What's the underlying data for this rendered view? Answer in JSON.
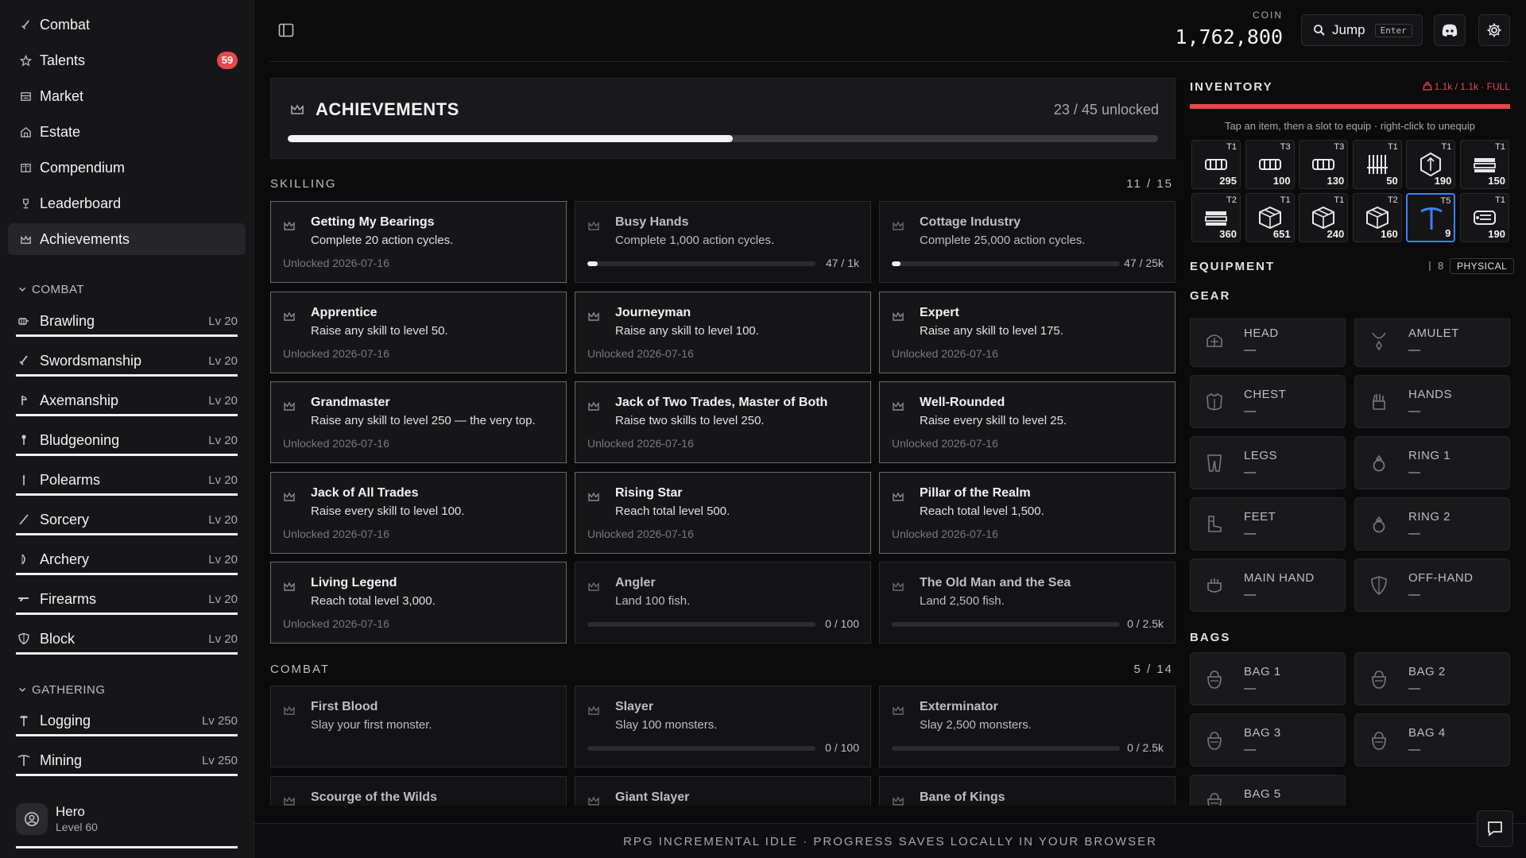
{
  "sidebar": {
    "nav": [
      {
        "label": "Combat",
        "icon": "sword-icon"
      },
      {
        "label": "Talents",
        "icon": "star-icon",
        "badge": "59"
      },
      {
        "label": "Market",
        "icon": "store-icon"
      },
      {
        "label": "Estate",
        "icon": "house-icon"
      },
      {
        "label": "Compendium",
        "icon": "book-icon"
      },
      {
        "label": "Leaderboard",
        "icon": "trophy-icon"
      },
      {
        "label": "Achievements",
        "icon": "crown-icon",
        "active": true
      }
    ],
    "sections": [
      {
        "title": "COMBAT",
        "skills": [
          {
            "name": "Brawling",
            "level": "Lv 20",
            "icon": "fist-icon",
            "progress": 1
          },
          {
            "name": "Swordsmanship",
            "level": "Lv 20",
            "icon": "sword-icon",
            "progress": 1
          },
          {
            "name": "Axemanship",
            "level": "Lv 20",
            "icon": "axe-icon",
            "progress": 1
          },
          {
            "name": "Bludgeoning",
            "level": "Lv 20",
            "icon": "mace-icon",
            "progress": 1
          },
          {
            "name": "Polearms",
            "level": "Lv 20",
            "icon": "spear-icon",
            "progress": 1
          },
          {
            "name": "Sorcery",
            "level": "Lv 20",
            "icon": "wand-icon",
            "progress": 1
          },
          {
            "name": "Archery",
            "level": "Lv 20",
            "icon": "bow-icon",
            "progress": 1
          },
          {
            "name": "Firearms",
            "level": "Lv 20",
            "icon": "gun-icon",
            "progress": 1
          },
          {
            "name": "Block",
            "level": "Lv 20",
            "icon": "shield-icon",
            "progress": 1
          }
        ]
      },
      {
        "title": "GATHERING",
        "skills": [
          {
            "name": "Logging",
            "level": "Lv 250",
            "icon": "hatchet-icon",
            "progress": 1
          },
          {
            "name": "Mining",
            "level": "Lv 250",
            "icon": "pickaxe-icon",
            "progress": 1
          }
        ]
      }
    ],
    "hero": {
      "name": "Hero",
      "level": "Level 60",
      "progress": 1
    }
  },
  "topbar": {
    "coin_label": "COIN",
    "coin_value": "1,762,800",
    "jump_label": "Jump",
    "jump_kbd": "Enter"
  },
  "achievements": {
    "title": "ACHIEVEMENTS",
    "count": "23 / 45 unlocked",
    "progress": 0.511,
    "sections": [
      {
        "label": "SKILLING",
        "count": "11 / 15",
        "items": [
          {
            "title": "Getting My Bearings",
            "desc": "Complete 20 action cycles.",
            "unlocked": true,
            "date": "Unlocked 2026-07-16"
          },
          {
            "title": "Busy Hands",
            "desc": "Complete 1,000 action cycles.",
            "unlocked": false,
            "progress_text": "47 / 1k",
            "progress": 0.047
          },
          {
            "title": "Cottage Industry",
            "desc": "Complete 25,000 action cycles.",
            "unlocked": false,
            "progress_text": "47 / 25k",
            "progress": 0.002
          },
          {
            "title": "Apprentice",
            "desc": "Raise any skill to level 50.",
            "unlocked": true,
            "date": "Unlocked 2026-07-16"
          },
          {
            "title": "Journeyman",
            "desc": "Raise any skill to level 100.",
            "unlocked": true,
            "date": "Unlocked 2026-07-16"
          },
          {
            "title": "Expert",
            "desc": "Raise any skill to level 175.",
            "unlocked": true,
            "date": "Unlocked 2026-07-16"
          },
          {
            "title": "Grandmaster",
            "desc": "Raise any skill to level 250 — the very top.",
            "unlocked": true,
            "date": "Unlocked 2026-07-16"
          },
          {
            "title": "Jack of Two Trades, Master of Both",
            "desc": "Raise two skills to level 250.",
            "unlocked": true,
            "date": "Unlocked 2026-07-16"
          },
          {
            "title": "Well-Rounded",
            "desc": "Raise every skill to level 25.",
            "unlocked": true,
            "date": "Unlocked 2026-07-16"
          },
          {
            "title": "Jack of All Trades",
            "desc": "Raise every skill to level 100.",
            "unlocked": true,
            "date": "Unlocked 2026-07-16"
          },
          {
            "title": "Rising Star",
            "desc": "Reach total level 500.",
            "unlocked": true,
            "date": "Unlocked 2026-07-16"
          },
          {
            "title": "Pillar of the Realm",
            "desc": "Reach total level 1,500.",
            "unlocked": true,
            "date": "Unlocked 2026-07-16"
          },
          {
            "title": "Living Legend",
            "desc": "Reach total level 3,000.",
            "unlocked": true,
            "date": "Unlocked 2026-07-16"
          },
          {
            "title": "Angler",
            "desc": "Land 100 fish.",
            "unlocked": false,
            "progress_text": "0 / 100",
            "progress": 0
          },
          {
            "title": "The Old Man and the Sea",
            "desc": "Land 2,500 fish.",
            "unlocked": false,
            "progress_text": "0 / 2.5k",
            "progress": 0
          }
        ]
      },
      {
        "label": "COMBAT",
        "count": "5 / 14",
        "items": [
          {
            "title": "First Blood",
            "desc": "Slay your first monster.",
            "unlocked": false
          },
          {
            "title": "Slayer",
            "desc": "Slay 100 monsters.",
            "unlocked": false,
            "progress_text": "0 / 100",
            "progress": 0
          },
          {
            "title": "Exterminator",
            "desc": "Slay 2,500 monsters.",
            "unlocked": false,
            "progress_text": "0 / 2.5k",
            "progress": 0
          },
          {
            "title": "Scourge of the Wilds",
            "desc": "",
            "unlocked": false
          },
          {
            "title": "Giant Slayer",
            "desc": "",
            "unlocked": false
          },
          {
            "title": "Bane of Kings",
            "desc": "",
            "unlocked": false
          }
        ]
      }
    ]
  },
  "inventory": {
    "title": "INVENTORY",
    "status": "1.1k / 1.1k · FULL",
    "fill": 1,
    "hint": "Tap an item, then a slot to equip · right-click to unequip",
    "items": [
      {
        "tier": "T1",
        "qty": "295",
        "icon": "log-icon"
      },
      {
        "tier": "T3",
        "qty": "100",
        "icon": "log-icon"
      },
      {
        "tier": "T3",
        "qty": "130",
        "icon": "log-icon"
      },
      {
        "tier": "T1",
        "qty": "50",
        "icon": "fence-icon"
      },
      {
        "tier": "T1",
        "qty": "190",
        "icon": "crystal-icon"
      },
      {
        "tier": "T1",
        "qty": "150",
        "icon": "ingot-icon"
      },
      {
        "tier": "T2",
        "qty": "360",
        "icon": "ingot-icon"
      },
      {
        "tier": "T1",
        "qty": "651",
        "icon": "crate-icon"
      },
      {
        "tier": "T1",
        "qty": "240",
        "icon": "crate-icon"
      },
      {
        "tier": "T2",
        "qty": "160",
        "icon": "crate-icon"
      },
      {
        "tier": "T5",
        "qty": "9",
        "icon": "pickaxe-icon",
        "selected": true
      },
      {
        "tier": "T1",
        "qty": "190",
        "icon": "scroll-icon"
      }
    ]
  },
  "equipment": {
    "title": "EQUIPMENT",
    "count": "8",
    "type": "PHYSICAL",
    "gear_title": "GEAR",
    "gear": [
      {
        "label": "HEAD",
        "value": "—",
        "icon": "helmet-icon"
      },
      {
        "label": "AMULET",
        "value": "—",
        "icon": "amulet-icon"
      },
      {
        "label": "CHEST",
        "value": "—",
        "icon": "chestplate-icon"
      },
      {
        "label": "HANDS",
        "value": "—",
        "icon": "gloves-icon"
      },
      {
        "label": "LEGS",
        "value": "—",
        "icon": "leggings-icon"
      },
      {
        "label": "RING 1",
        "value": "—",
        "icon": "ring-icon"
      },
      {
        "label": "FEET",
        "value": "—",
        "icon": "boots-icon"
      },
      {
        "label": "RING 2",
        "value": "—",
        "icon": "ring-icon"
      },
      {
        "label": "MAIN HAND",
        "value": "—",
        "icon": "gauntlet-icon"
      },
      {
        "label": "OFF-HAND",
        "value": "—",
        "icon": "shield-icon"
      }
    ],
    "bags_title": "BAGS",
    "bags": [
      {
        "label": "BAG 1",
        "value": "—",
        "icon": "bag-icon"
      },
      {
        "label": "BAG 2",
        "value": "—",
        "icon": "bag-icon"
      },
      {
        "label": "BAG 3",
        "value": "—",
        "icon": "bag-icon"
      },
      {
        "label": "BAG 4",
        "value": "—",
        "icon": "bag-icon"
      },
      {
        "label": "BAG 5",
        "value": "",
        "icon": "bag-icon"
      }
    ]
  },
  "footer": {
    "text": "RPG INCREMENTAL IDLE · PROGRESS SAVES LOCALLY IN YOUR BROWSER"
  }
}
